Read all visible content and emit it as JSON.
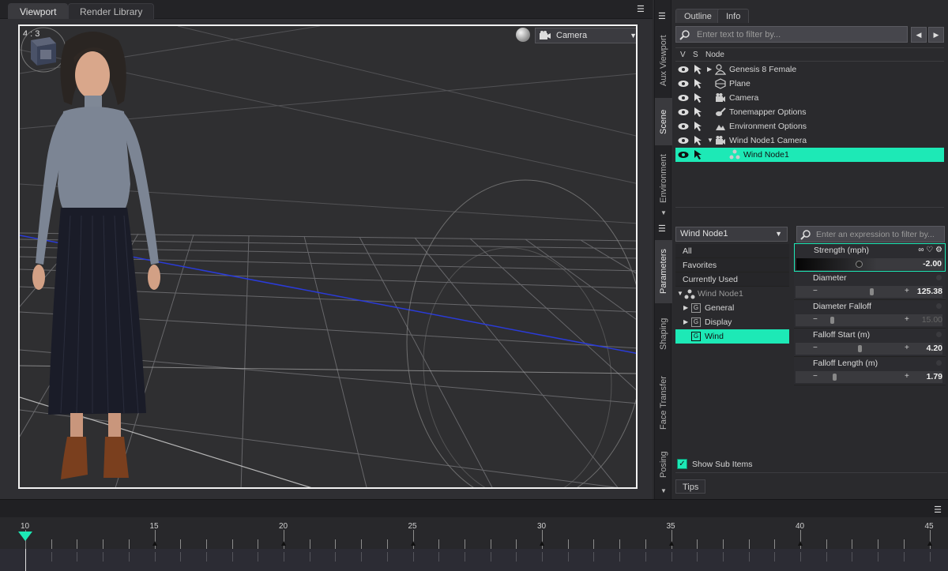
{
  "viewport": {
    "tabs": [
      {
        "label": "Viewport",
        "active": true
      },
      {
        "label": "Render Library",
        "active": false
      }
    ],
    "aspect_ratio": "4 : 3",
    "camera": "Camera"
  },
  "side_tabs": {
    "top": [
      "Aux Viewport",
      "Scene",
      "Environment"
    ],
    "bottom": [
      "Parameters",
      "Shaping",
      "Face Transfer",
      "Posing"
    ]
  },
  "outline": {
    "tabs": [
      {
        "label": "Outline",
        "active": true
      },
      {
        "label": "Info",
        "active": false
      }
    ],
    "filter_placeholder": "Enter text to filter by...",
    "columns": {
      "v": "V",
      "s": "S",
      "node": "Node"
    },
    "nodes": [
      {
        "label": "Genesis 8 Female",
        "icon": "figure-icon",
        "expandable": true,
        "expanded": false,
        "selected": false
      },
      {
        "label": "Plane",
        "icon": "plane-icon",
        "expandable": false,
        "expanded": false,
        "selected": false
      },
      {
        "label": "Camera",
        "icon": "camera-icon",
        "expandable": false,
        "expanded": false,
        "selected": false
      },
      {
        "label": "Tonemapper Options",
        "icon": "tonemapper-icon",
        "expandable": false,
        "expanded": false,
        "selected": false
      },
      {
        "label": "Environment Options",
        "icon": "environment-icon",
        "expandable": false,
        "expanded": false,
        "selected": false
      },
      {
        "label": "Wind Node1 Camera",
        "icon": "camera-icon",
        "expandable": true,
        "expanded": true,
        "selected": false
      },
      {
        "label": "Wind Node1",
        "icon": "wind-node-icon",
        "expandable": false,
        "expanded": false,
        "selected": true
      }
    ]
  },
  "parameters": {
    "node_select": "Wind Node1",
    "filter_placeholder": "Enter an expression to filter by...",
    "groups": [
      "All",
      "Favorites",
      "Currently Used"
    ],
    "tree_root": "Wind Node1",
    "tree_children": [
      {
        "label": "General",
        "selected": false
      },
      {
        "label": "Display",
        "selected": false
      },
      {
        "label": "Wind",
        "selected": true
      }
    ],
    "show_sub_items": "Show Sub Items",
    "show_sub_items_checked": true,
    "items": [
      {
        "label": "Strength (mph)",
        "value": "-2.00",
        "fraction": 0.5,
        "active": true,
        "disabled": false
      },
      {
        "label": "Diameter",
        "value": "125.38",
        "fraction": 0.62,
        "active": false,
        "disabled": false
      },
      {
        "label": "Diameter Falloff",
        "value": "15.00",
        "fraction": 0.15,
        "active": false,
        "disabled": true
      },
      {
        "label": "Falloff Start (m)",
        "value": "4.20",
        "fraction": 0.48,
        "active": false,
        "disabled": false
      },
      {
        "label": "Falloff Length (m)",
        "value": "1.79",
        "fraction": 0.18,
        "active": false,
        "disabled": false
      }
    ]
  },
  "tips_tab": "Tips",
  "timeline": {
    "current_frame": 10,
    "labels": [
      "10",
      "15",
      "20",
      "25",
      "30",
      "35",
      "40",
      "45"
    ]
  },
  "colors": {
    "accent": "#1de9b6",
    "panel": "#2a2a2d",
    "viewport_bg": "#2f2f31",
    "frame_border": "#f2f2f2"
  }
}
